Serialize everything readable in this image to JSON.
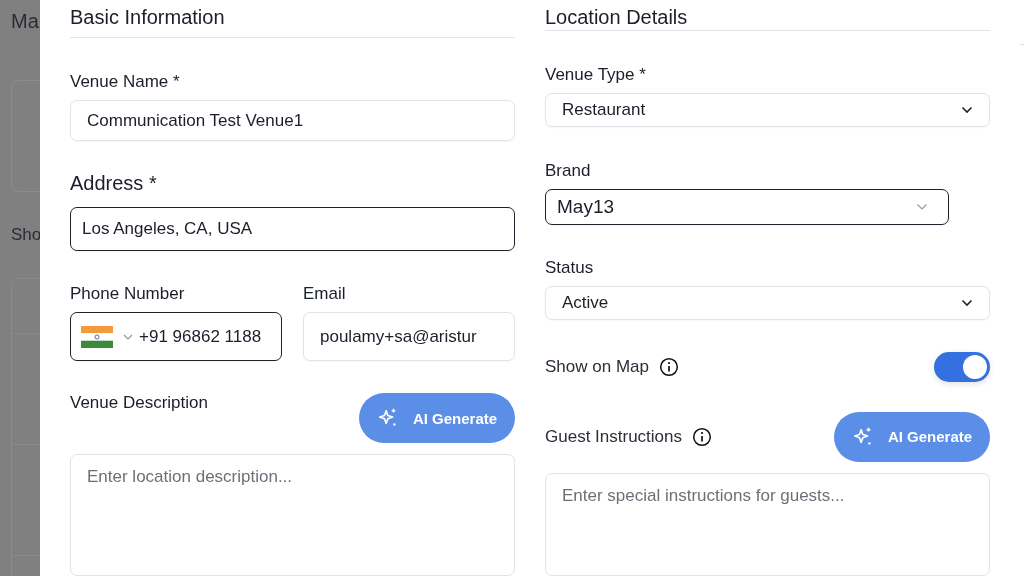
{
  "backdrop": {
    "texts": [
      "Ma",
      "Sho"
    ]
  },
  "basic": {
    "title": "Basic Information",
    "venue_name": {
      "label": "Venue Name *",
      "value": "Communication Test Venue1",
      "focused": false
    },
    "address": {
      "label": "Address *",
      "value": "Los Angeles, CA, USA",
      "focused": true
    },
    "phone": {
      "label": "Phone Number",
      "value": "+91 96862 1188",
      "focused": true
    },
    "email": {
      "label": "Email",
      "value": "poulamy+sa@aristur",
      "focused": false
    },
    "description": {
      "label": "Venue Description",
      "button": "AI Generate",
      "placeholder": "Enter location description..."
    }
  },
  "location": {
    "title": "Location Details",
    "venue_type": {
      "label": "Venue Type *",
      "value": "Restaurant",
      "focused": false
    },
    "brand": {
      "label": "Brand",
      "value": "May13",
      "focused": true
    },
    "status": {
      "label": "Status",
      "value": "Active",
      "focused": false
    },
    "show_on_map": {
      "label": "Show on Map",
      "on": true
    },
    "guest_instructions": {
      "label": "Guest Instructions",
      "button": "AI Generate",
      "placeholder": "Enter special instructions for guests..."
    }
  }
}
